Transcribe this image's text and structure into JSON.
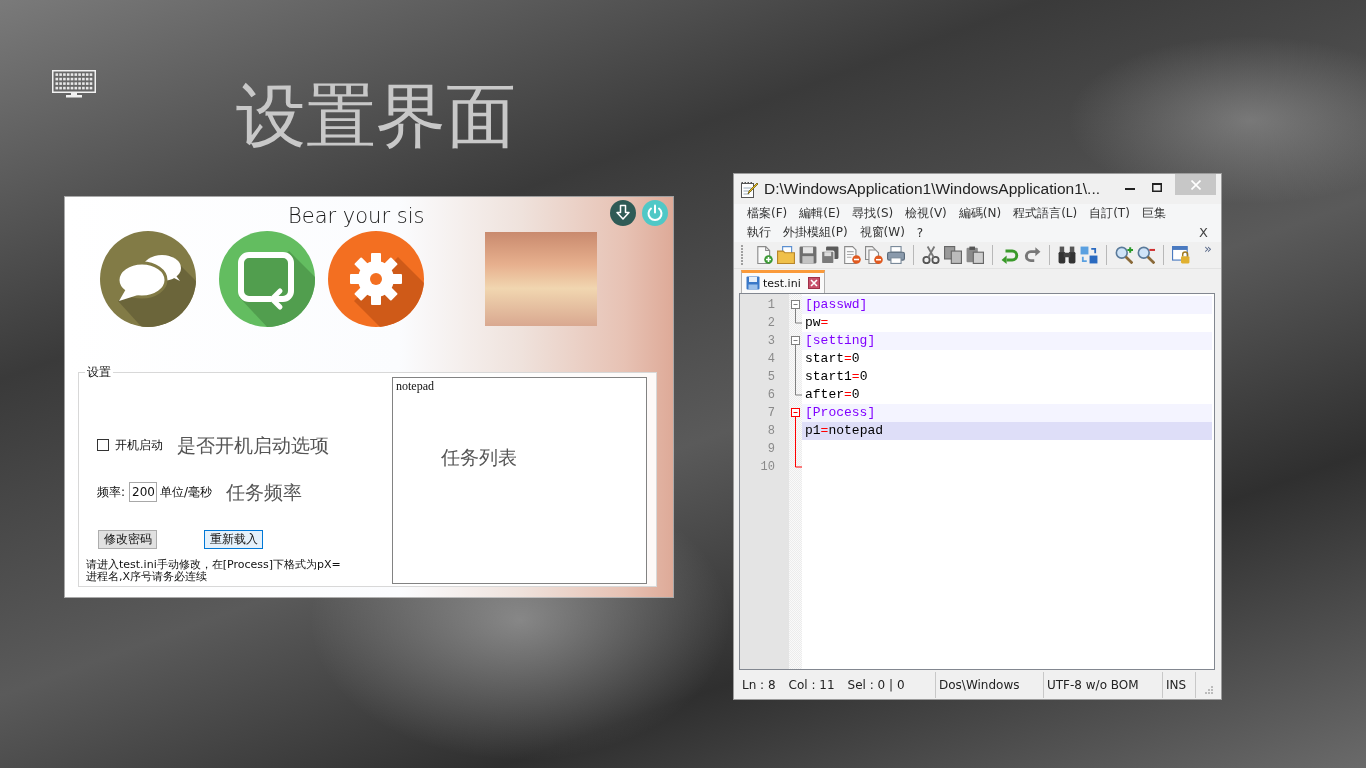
{
  "heading": "设置界面",
  "settings_window": {
    "title": "Bear your sis",
    "settings_group": {
      "legend": "设置",
      "autostart": {
        "label": "开机启动",
        "checked": false
      },
      "autostart_note": "是否开机启动选项",
      "frequency": {
        "label": "频率:",
        "value": "200",
        "unit": "单位/毫秒"
      },
      "frequency_note": "任务频率",
      "buttons": [
        {
          "label": "修改密码",
          "focused": false
        },
        {
          "label": "重新载入",
          "focused": true
        }
      ],
      "hint": "请进入test.ini手动修改，在[Process]下格式为pX=进程名,X序号请务必连续",
      "task_list": {
        "items": [
          {
            "name": "notepad",
            "selected": false
          }
        ],
        "note": "任务列表"
      }
    }
  },
  "editor_window": {
    "title": "D:\\WindowsApplication1\\WindowsApplication1\\...",
    "menu_rows": [
      {
        "items": [
          "檔案(F)",
          "編輯(E)",
          "尋找(S)",
          "檢視(V)",
          "編碼(N)",
          "程式語言(L)",
          "自訂(T)",
          "巨集"
        ]
      },
      {
        "items": [
          "執行",
          "外掛模組(P)",
          "視窗(W)",
          "?"
        ]
      }
    ],
    "menu_close": "X",
    "toolbar_overflow": "»",
    "tabs": [
      {
        "label": "test.ini",
        "selected": true
      }
    ],
    "lines": [
      {
        "number": "1",
        "kind": "section",
        "text": "[passwd]",
        "expanded": true,
        "fold_active": false,
        "current": false,
        "children": [
          {
            "number": "2",
            "kind": "pair",
            "key": "pw",
            "sign": "=",
            "current": false
          }
        ]
      },
      {
        "number": "3",
        "kind": "section",
        "text": "[setting]",
        "expanded": true,
        "fold_active": false,
        "current": false,
        "children": [
          {
            "number": "4",
            "kind": "pair",
            "key": "start",
            "sign": "=",
            "value": "0",
            "current": false
          },
          {
            "number": "5",
            "kind": "pair",
            "key": "start1",
            "sign": "=",
            "value": "0",
            "current": false
          },
          {
            "number": "6",
            "kind": "pair",
            "key": "after",
            "sign": "=",
            "value": "0",
            "current": false
          }
        ]
      },
      {
        "number": "7",
        "kind": "section",
        "text": "[Process]",
        "expanded": true,
        "fold_active": true,
        "current": false,
        "children": [
          {
            "number": "8",
            "kind": "pair",
            "key": "p1",
            "sign": "=",
            "value": "notepad",
            "current": true
          },
          {
            "number": "9",
            "kind": "blank",
            "current": false
          },
          {
            "number": "10",
            "kind": "blank",
            "current": false
          }
        ]
      }
    ],
    "status_bar": {
      "position": [
        "Ln : 8",
        "Col : 11",
        "Sel : 0 | 0"
      ],
      "line_endings": "Dos\\Windows",
      "encoding": "UTF-8 w/o BOM",
      "mode": "INS"
    }
  }
}
